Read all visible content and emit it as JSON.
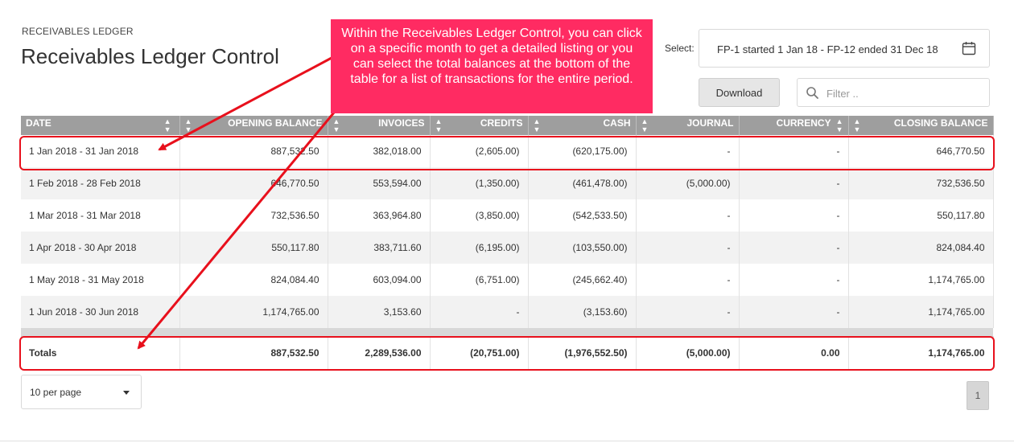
{
  "header": {
    "breadcrumb": "RECEIVABLES LEDGER",
    "title": "Receivables Ledger Control"
  },
  "controls": {
    "select_label": "Select:",
    "period_value": "FP-1 started 1 Jan 18 - FP-12 ended 31 Dec 18",
    "download_label": "Download",
    "filter_placeholder": "Filter .."
  },
  "table": {
    "columns": [
      "DATE",
      "OPENING BALANCE",
      "INVOICES",
      "CREDITS",
      "CASH",
      "JOURNAL",
      "CURRENCY",
      "CLOSING BALANCE"
    ],
    "rows": [
      [
        "1 Jan 2018 - 31 Jan 2018",
        "887,532.50",
        "382,018.00",
        "(2,605.00)",
        "(620,175.00)",
        "-",
        "-",
        "646,770.50"
      ],
      [
        "1 Feb 2018 - 28 Feb 2018",
        "646,770.50",
        "553,594.00",
        "(1,350.00)",
        "(461,478.00)",
        "(5,000.00)",
        "-",
        "732,536.50"
      ],
      [
        "1 Mar 2018 - 31 Mar 2018",
        "732,536.50",
        "363,964.80",
        "(3,850.00)",
        "(542,533.50)",
        "-",
        "-",
        "550,117.80"
      ],
      [
        "1 Apr 2018 - 30 Apr 2018",
        "550,117.80",
        "383,711.60",
        "(6,195.00)",
        "(103,550.00)",
        "-",
        "-",
        "824,084.40"
      ],
      [
        "1 May 2018 - 31 May 2018",
        "824,084.40",
        "603,094.00",
        "(6,751.00)",
        "(245,662.40)",
        "-",
        "-",
        "1,174,765.00"
      ],
      [
        "1 Jun 2018 - 30 Jun 2018",
        "1,174,765.00",
        "3,153.60",
        "-",
        "(3,153.60)",
        "-",
        "-",
        "1,174,765.00"
      ]
    ],
    "totals": [
      "Totals",
      "887,532.50",
      "2,289,536.00",
      "(20,751.00)",
      "(1,976,552.50)",
      "(5,000.00)",
      "0.00",
      "1,174,765.00"
    ]
  },
  "pagination": {
    "page_size_label": "10 per page",
    "current_page": "1"
  },
  "annotation": {
    "callout_text": "Within the Receivables Ledger Control, you can click on a specific month to get a detailed listing or you can select the total balances at the bottom of the table for a list of transactions for the entire period.",
    "callout_color": "#ff2b62",
    "highlight_color": "#e8101c"
  },
  "colors": {
    "header_bg": "#9e9e9e",
    "stripe_bg": "#f2f2f2"
  }
}
